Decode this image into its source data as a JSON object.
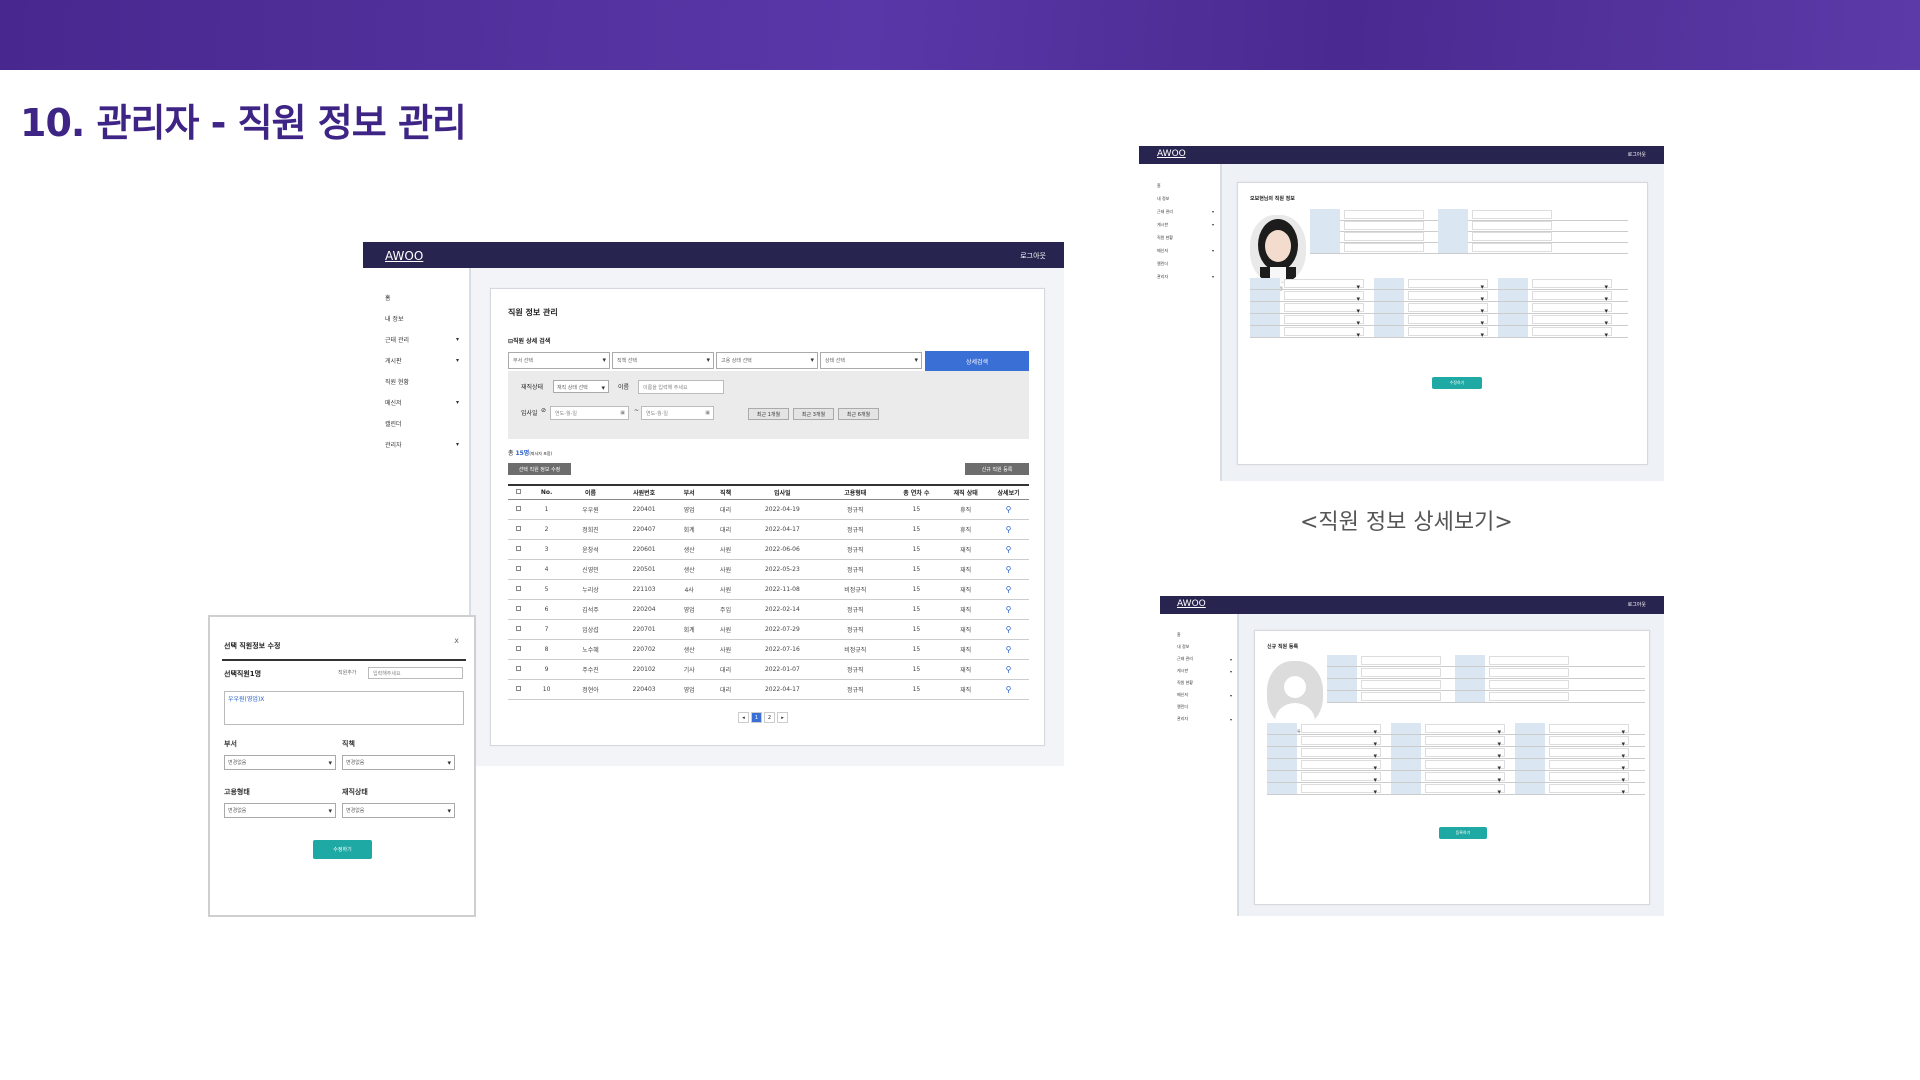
{
  "slide": {
    "title": "10. 관리자 - 직원 정보 관리",
    "caption": "<직원 정보 상세보기>"
  },
  "app": {
    "logo": "AWOO",
    "logout": "로그아웃"
  },
  "nav": [
    {
      "label": "홈",
      "arrow": ""
    },
    {
      "label": "내 정보",
      "arrow": ""
    },
    {
      "label": "근태 관리",
      "arrow": "▾"
    },
    {
      "label": "게시판",
      "arrow": "▾"
    },
    {
      "label": "직원 현황",
      "arrow": ""
    },
    {
      "label": "메신저",
      "arrow": "▾"
    },
    {
      "label": "캘린더",
      "arrow": ""
    },
    {
      "label": "관리자",
      "arrow": "▾"
    }
  ],
  "main": {
    "title": "직원 정보 관리",
    "search_toggle": "직원 상세 검색",
    "filters": [
      "부서 선택",
      "직책 선택",
      "고용 상태 선택",
      "상태 선택"
    ],
    "search_button": "상세검색",
    "work_status_label": "재직상태",
    "work_status_value": "재직 상태 선택",
    "name_label": "이름",
    "name_placeholder": "이름을 입력해 주세요",
    "hire_label": "입사일",
    "date_placeholder": "연도-월-일",
    "range_buttons": [
      "최근 1개월",
      "최근 3개월",
      "최근 6개월"
    ],
    "total_prefix": "총",
    "total_count": "15명",
    "total_suffix": "(퇴사자 포함)",
    "bulk_button": "선택 직원 정보 수정",
    "new_button": "신규 직원 등록",
    "columns": [
      "",
      "No.",
      "이름",
      "사원번호",
      "부서",
      "직책",
      "입사일",
      "고용형태",
      "총 연차 수",
      "재직 상태",
      "상세보기"
    ],
    "rows": [
      [
        "1",
        "우우원",
        "220401",
        "영업",
        "대리",
        "2022-04-19",
        "정규직",
        "15",
        "휴직"
      ],
      [
        "2",
        "정희진",
        "220407",
        "회계",
        "대리",
        "2022-04-17",
        "정규직",
        "15",
        "휴직"
      ],
      [
        "3",
        "윤창석",
        "220601",
        "생산",
        "사원",
        "2022-06-06",
        "정규직",
        "15",
        "재직"
      ],
      [
        "4",
        "신영민",
        "220501",
        "생산",
        "사원",
        "2022-05-23",
        "정규직",
        "15",
        "재직"
      ],
      [
        "5",
        "누리상",
        "221103",
        "4사",
        "사원",
        "2022-11-08",
        "비정규직",
        "15",
        "재직"
      ],
      [
        "6",
        "김석주",
        "220204",
        "영업",
        "주임",
        "2022-02-14",
        "정규직",
        "15",
        "재직"
      ],
      [
        "7",
        "임상섭",
        "220701",
        "회계",
        "사원",
        "2022-07-29",
        "정규직",
        "15",
        "재직"
      ],
      [
        "8",
        "노수혜",
        "220702",
        "생산",
        "사원",
        "2022-07-16",
        "비정규직",
        "15",
        "재직"
      ],
      [
        "9",
        "주수진",
        "220102",
        "기사",
        "대리",
        "2022-01-07",
        "정규직",
        "15",
        "재직"
      ],
      [
        "10",
        "정현아",
        "220403",
        "영업",
        "대리",
        "2022-04-17",
        "정규직",
        "15",
        "재직"
      ]
    ],
    "pages": [
      "◂",
      "1",
      "2",
      "▸"
    ]
  },
  "modal": {
    "title": "선택 직원정보 수정",
    "close": "x",
    "selected_count": "선택직원1명",
    "search_label": "직원추가",
    "search_placeholder": "입력해주세요",
    "selected_tag": "우우원(영업)X",
    "dept_label": "부서",
    "position_label": "직책",
    "employ_label": "고용형태",
    "status_label": "재직상태",
    "unchanged": "변경없음",
    "submit": "수정하기"
  },
  "detail": {
    "title": "오보현님의 직원 정보",
    "photo_caption": "사진변경",
    "save": "수정하기",
    "back": "목록"
  },
  "register": {
    "title": "신규 직원 등록",
    "photo_caption": "사진등록",
    "save": "등록하기",
    "back": "목록"
  },
  "colors": {
    "banner": "#4b2b95",
    "title": "#3d2485",
    "topbar": "#27254f",
    "primary": "#3a6fd6",
    "teal": "#1fa9a4"
  },
  "icons": [
    "search-icon",
    "close-icon",
    "chevron-down-icon",
    "calendar-icon"
  ]
}
